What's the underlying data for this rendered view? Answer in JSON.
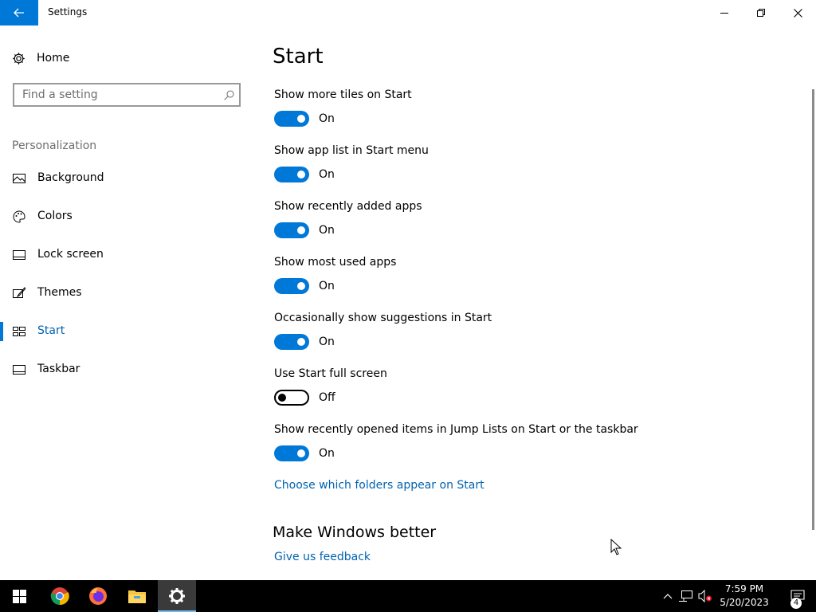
{
  "window": {
    "title": "Settings",
    "controls": [
      "minimize-icon",
      "restore-icon",
      "close-icon"
    ]
  },
  "sidebar": {
    "home_label": "Home",
    "search_placeholder": "Find a setting",
    "section_label": "Personalization",
    "items": [
      {
        "label": "Background",
        "icon": "picture-icon"
      },
      {
        "label": "Colors",
        "icon": "palette-icon"
      },
      {
        "label": "Lock screen",
        "icon": "lock-screen-icon"
      },
      {
        "label": "Themes",
        "icon": "brush-icon"
      },
      {
        "label": "Start",
        "icon": "start-tiles-icon",
        "selected": true
      },
      {
        "label": "Taskbar",
        "icon": "taskbar-icon"
      }
    ]
  },
  "main": {
    "title": "Start",
    "settings": [
      {
        "label": "Show more tiles on Start",
        "state": "On"
      },
      {
        "label": "Show app list in Start menu",
        "state": "On"
      },
      {
        "label": "Show recently added apps",
        "state": "On"
      },
      {
        "label": "Show most used apps",
        "state": "On"
      },
      {
        "label": "Occasionally show suggestions in Start",
        "state": "On"
      },
      {
        "label": "Use Start full screen",
        "state": "Off"
      },
      {
        "label": "Show recently opened items in Jump Lists on Start or the taskbar",
        "state": "On"
      }
    ],
    "folders_link": "Choose which folders appear on Start",
    "feedback_heading": "Make Windows better",
    "feedback_link": "Give us feedback"
  },
  "taskbar": {
    "apps": [
      "windows-start-icon",
      "chrome-icon",
      "firefox-icon",
      "file-explorer-icon",
      "settings-gear-icon"
    ],
    "time": "7:59 PM",
    "date": "5/20/2023",
    "notification_count": "4"
  },
  "colors": {
    "accent": "#0078d7",
    "link": "#0063b1",
    "taskbar": "#000000"
  }
}
